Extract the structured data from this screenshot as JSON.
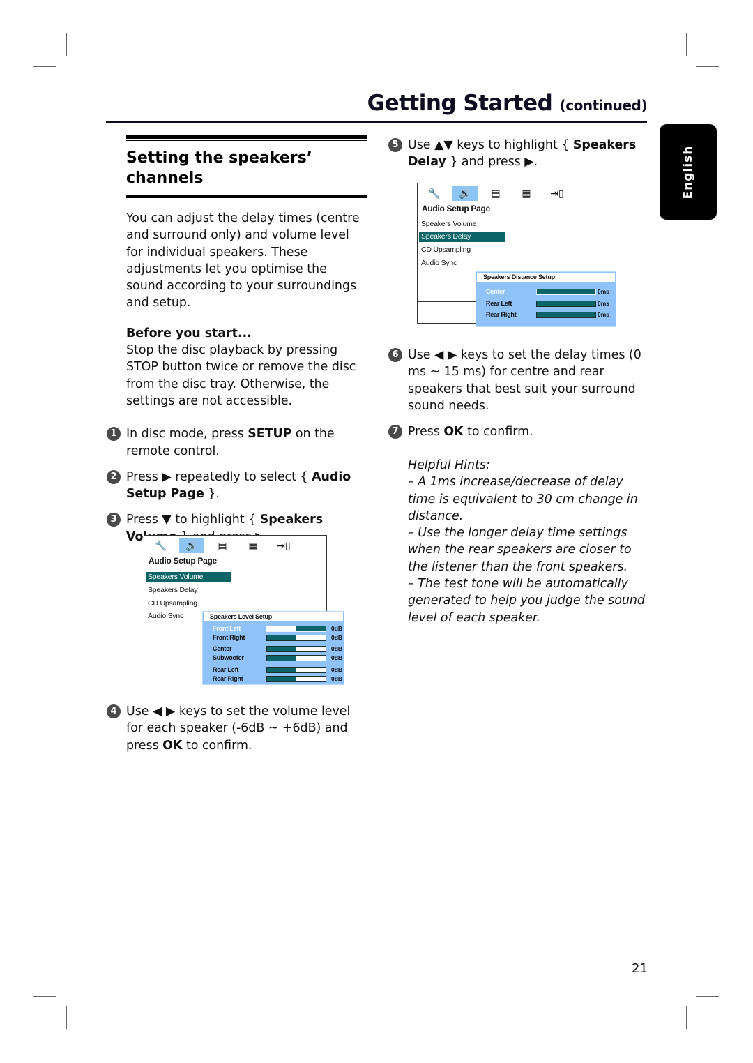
{
  "header": {
    "title": "Getting Started",
    "title_suffix": "(continued)"
  },
  "language_tab": "English",
  "section": {
    "title_line1": "Setting the speakers’",
    "title_line2": "channels",
    "intro": "You can adjust the delay times (centre and surround only) and volume level for individual speakers. These adjustments let you optimise the sound according to your surroundings and setup.",
    "before_heading": "Before you start...",
    "before_text": "Stop the disc playback by pressing STOP button twice or remove the disc from the disc tray. Otherwise, the settings are not accessible."
  },
  "steps": [
    {
      "num": "1",
      "a": "In disc mode, press ",
      "b": "SETUP",
      "c": " on the remote control."
    },
    {
      "num": "2",
      "a": "Press ▶ repeatedly to select { ",
      "b": "Audio Setup Page",
      "c": " }."
    },
    {
      "num": "3",
      "a": "Press ▼ to highlight { ",
      "b": "Speakers Volume",
      "c": " } and press ▶."
    },
    {
      "num": "4",
      "a": "Use ◀ ▶ keys to set the volume level for each speaker (-6dB ~ +6dB) and press ",
      "b": "OK",
      "c": " to confirm."
    },
    {
      "num": "5",
      "a": "Use ▲▼ keys to highlight { ",
      "b": "Speakers Delay",
      "c": " } and press ▶."
    },
    {
      "num": "6",
      "a": "Use ◀ ▶ keys to set the delay times (0 ms ~ 15 ms) for centre and rear speakers that best suit your surround sound needs.",
      "b": "",
      "c": ""
    },
    {
      "num": "7",
      "a": "Press ",
      "b": "OK",
      "c": " to confirm."
    }
  ],
  "osd": {
    "icons": [
      "general-setup-icon",
      "audio-speaker-icon",
      "video-film-icon",
      "preference-grid-icon",
      "exit-door-icon"
    ],
    "page_title": "Audio Setup Page",
    "menu": [
      "Speakers Volume",
      "Speakers Delay",
      "CD Upsampling",
      "Audio Sync"
    ],
    "level_panel": {
      "title": "Speakers Level Setup",
      "rows": [
        {
          "label": "Front Left",
          "value": "0dB",
          "level_pct": 50,
          "active": true
        },
        {
          "label": "Front Right",
          "value": "0dB",
          "level_pct": 50,
          "active": false
        },
        {
          "label": "Center",
          "value": "0dB",
          "level_pct": 50,
          "active": false
        },
        {
          "label": "Subwoofer",
          "value": "0dB",
          "level_pct": 50,
          "active": false
        },
        {
          "label": "Rear Left",
          "value": "0dB",
          "level_pct": 50,
          "active": false
        },
        {
          "label": "Rear Right",
          "value": "0dB",
          "level_pct": 50,
          "active": false
        }
      ]
    },
    "distance_panel": {
      "title": "Speakers Distance Setup",
      "rows": [
        {
          "label": "Center",
          "value": "0ms",
          "level_pct": 100,
          "active": true
        },
        {
          "label": "Rear Left",
          "value": "0ms",
          "level_pct": 100,
          "active": false
        },
        {
          "label": "Rear Right",
          "value": "0ms",
          "level_pct": 100,
          "active": false
        }
      ]
    }
  },
  "hints": {
    "heading": "Helpful Hints:",
    "items": [
      "– A 1ms increase/decrease of delay time is equivalent to 30 cm change in distance.",
      "– Use the longer delay time settings when the rear speakers are closer to the listener than the front speakers.",
      "– The test tone will be automatically generated to help you judge the sound level of each speaker."
    ]
  },
  "page_number": "21"
}
